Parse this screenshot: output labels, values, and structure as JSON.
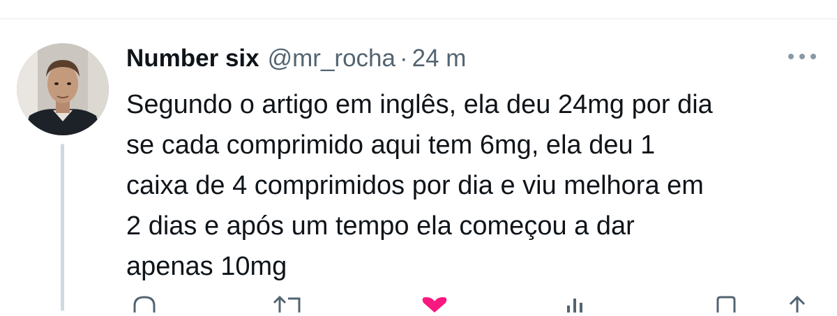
{
  "tweet": {
    "display_name": "Number six",
    "handle": "@mr_rocha",
    "separator": "·",
    "timestamp": "24 m",
    "text": "Segundo o artigo em inglês, ela deu 24mg por dia\nse cada comprimido aqui tem 6mg, ela deu 1\ncaixa de 4 comprimidos por dia e viu melhora em\n2 dias e após um tempo ela começou a dar\napenas 10mg"
  },
  "icons": {
    "more": "more-horizontal-icon",
    "reply": "reply-icon",
    "retweet": "retweet-icon",
    "like": "heart-icon",
    "views": "views-icon",
    "bookmark": "bookmark-icon",
    "share": "share-icon"
  },
  "colors": {
    "text_primary": "#0f1419",
    "text_secondary": "#536471",
    "divider": "#eff3f4",
    "thread_line": "#cfd9de",
    "like": "#f91880"
  }
}
